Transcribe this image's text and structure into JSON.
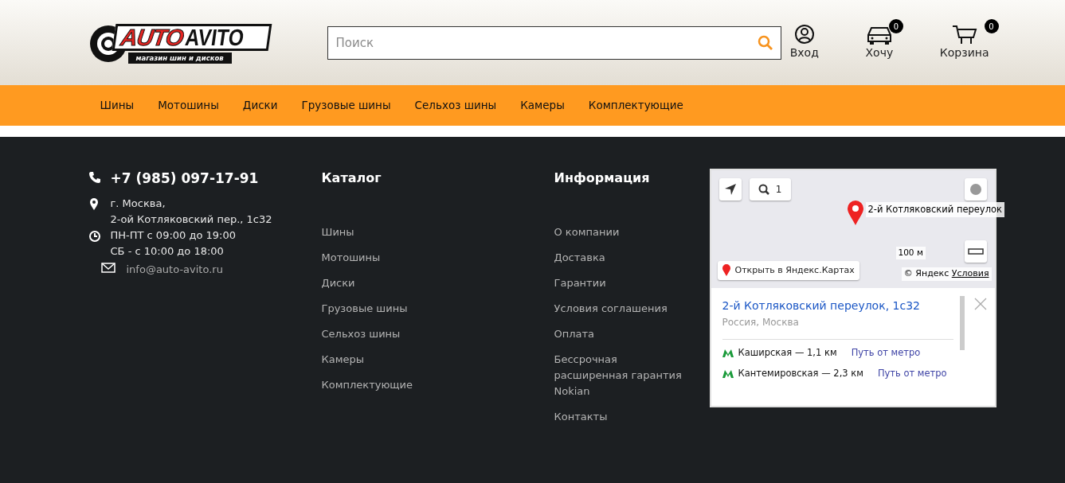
{
  "header": {
    "logo": {
      "word_1": "AUTO",
      "word_2": "AVITO",
      "tagline": "магазин шин и дисков"
    },
    "search": {
      "placeholder": "Поиск"
    },
    "actions": [
      {
        "kind": "user",
        "label": "Вход"
      },
      {
        "kind": "car",
        "label": "Хочу",
        "count": "0"
      },
      {
        "kind": "cart",
        "label": "Корзина",
        "count": "0"
      }
    ]
  },
  "nav": [
    "Шины",
    "Мотошины",
    "Диски",
    "Грузовые шины",
    "Сельхоз шины",
    "Камеры",
    "Комплектующие"
  ],
  "footer": {
    "contacts": [
      {
        "kind": "phone",
        "lines": [
          "+7 (985) 097-17-91"
        ]
      },
      {
        "kind": "address",
        "lines": [
          "г. Москва,",
          "2-ой Котляковский пер., 1с32"
        ]
      },
      {
        "kind": "hours",
        "lines": [
          "ПН-ПТ с 09:00 до 19:00",
          "СБ - с 10:00 до 18:00"
        ]
      },
      {
        "kind": "email",
        "lines": [
          "info@auto-avito.ru"
        ]
      }
    ],
    "columns": [
      {
        "title": "Каталог",
        "links": [
          "Шины",
          "Мотошины",
          "Диски",
          "Грузовые шины",
          "Сельхоз шины",
          "Камеры",
          "Комплектующие"
        ]
      },
      {
        "title": "Информация",
        "links": [
          "О компании",
          "Доставка",
          "Гарантии",
          "Условия соглашения",
          "Оплата",
          "Бессрочная расширенная гарантия Nokian",
          "Контакты"
        ]
      }
    ],
    "map": {
      "zoom": "1",
      "placemark_label": "2-й Котляковский переулок",
      "scale": "100 м",
      "open_link": "Открыть в Яндекс.Картах",
      "copyright": "© Яндекс",
      "terms": "Условия",
      "balloon": {
        "title": "2-й Котляковский переулок, 1с32",
        "subtitle": "Россия, Москва",
        "metro": [
          {
            "station": "Каширская — 1,1 км",
            "route": "Путь от метро"
          },
          {
            "station": "Кантемировская — 2,3 км",
            "route": "Путь от метро"
          }
        ]
      }
    }
  }
}
